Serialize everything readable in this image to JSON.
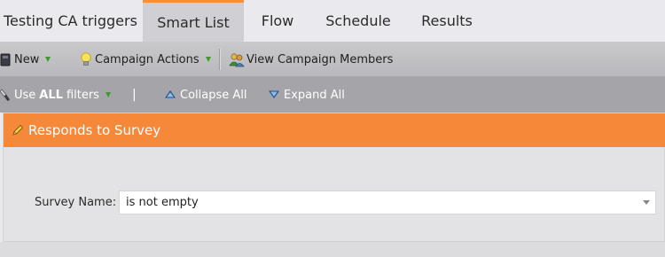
{
  "tabs": [
    {
      "label": "Testing CA triggers",
      "active": false
    },
    {
      "label": "Smart List",
      "active": true
    },
    {
      "label": "Flow",
      "active": false
    },
    {
      "label": "Schedule",
      "active": false
    },
    {
      "label": "Results",
      "active": false
    }
  ],
  "toolbar": {
    "new_label": "New",
    "campaign_actions_label": "Campaign Actions",
    "view_members_label": "View Campaign Members"
  },
  "filterbar": {
    "use_prefix": "Use",
    "use_bold": "ALL",
    "use_suffix": "filters",
    "divider": "|",
    "collapse_label": "Collapse All",
    "expand_label": "Expand All"
  },
  "filter": {
    "title": "Responds to Survey",
    "field_label": "Survey Name:",
    "operator_value": "is not empty"
  },
  "colors": {
    "accent_orange": "#f6883a",
    "active_tab_border": "#f5903a",
    "dropdown_green": "#3f9a2e"
  },
  "icons": [
    "new-icon",
    "lightbulb-icon",
    "members-icon",
    "wrench-icon",
    "collapse-icon",
    "expand-icon",
    "pencil-icon"
  ]
}
